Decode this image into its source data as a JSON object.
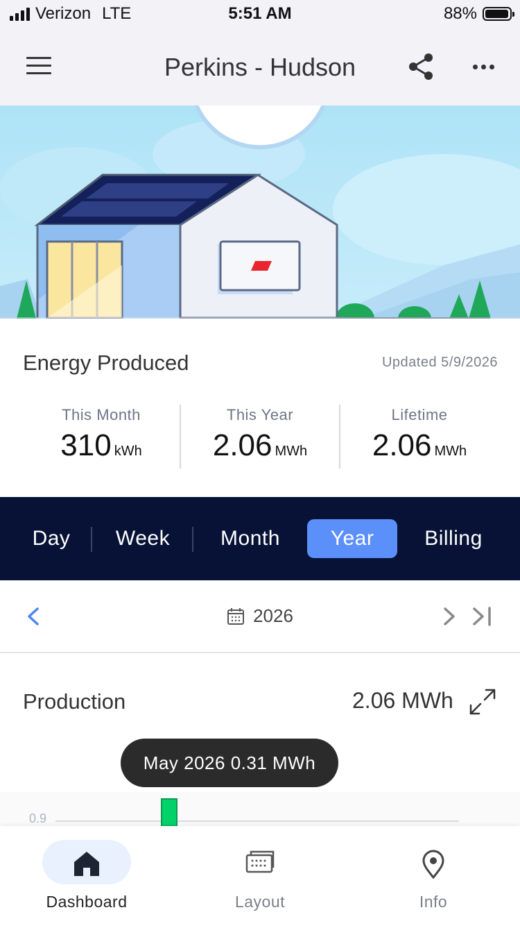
{
  "status_bar": {
    "carrier": "Verizon",
    "network": "LTE",
    "time": "5:51 AM",
    "battery": "88%"
  },
  "header": {
    "title": "Perkins - Hudson"
  },
  "energy": {
    "title": "Energy Produced",
    "updated": "Updated 5/9/2026",
    "stats": [
      {
        "label": "This Month",
        "value": "310",
        "unit": "kWh"
      },
      {
        "label": "This Year",
        "value": "2.06",
        "unit": "MWh"
      },
      {
        "label": "Lifetime",
        "value": "2.06",
        "unit": "MWh"
      }
    ]
  },
  "tabs": {
    "items": [
      "Day",
      "Week",
      "Month",
      "Year",
      "Billing"
    ],
    "active": "Year"
  },
  "date_nav": {
    "label": "2026"
  },
  "production": {
    "title": "Production",
    "total": "2.06 MWh",
    "tooltip": "May 2026 0.31 MWh"
  },
  "chart_data": {
    "type": "bar",
    "ytick_labels": [
      "0.9"
    ]
  },
  "bottom_nav": {
    "items": [
      {
        "label": "Dashboard",
        "icon": "home-icon",
        "active": true
      },
      {
        "label": "Layout",
        "icon": "solar-panel-icon",
        "active": false
      },
      {
        "label": "Info",
        "icon": "location-pin-icon",
        "active": false
      }
    ]
  },
  "colors": {
    "accent": "#5b8ff9",
    "tab_bar": "#071236",
    "bar": "#00d26a",
    "tooltip": "#2b2b2b"
  }
}
